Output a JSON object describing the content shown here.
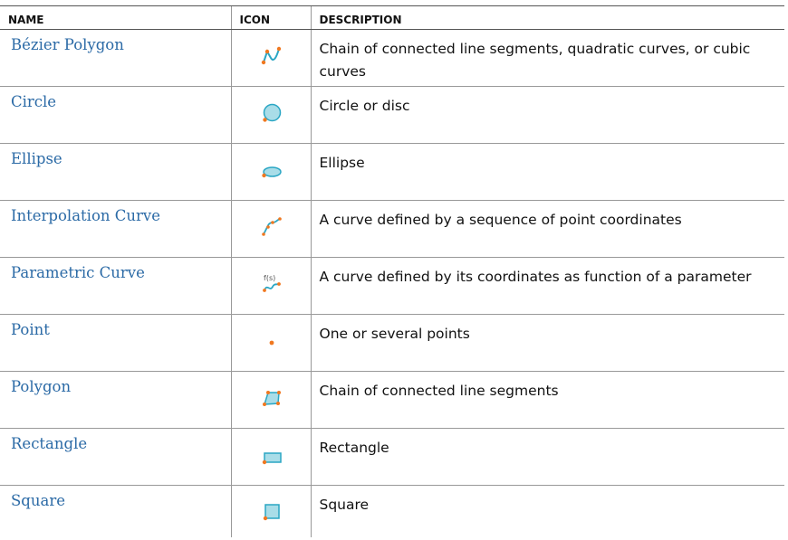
{
  "headers": {
    "name": "NAME",
    "icon": "ICON",
    "description": "DESCRIPTION"
  },
  "rows": [
    {
      "name": "Bézier Polygon",
      "icon": "bezier-polygon-icon",
      "description": "Chain of connected line segments, quadratic curves, or cubic curves"
    },
    {
      "name": "Circle",
      "icon": "circle-icon",
      "description": "Circle or disc"
    },
    {
      "name": "Ellipse",
      "icon": "ellipse-icon",
      "description": "Ellipse"
    },
    {
      "name": "Interpolation Curve",
      "icon": "interpolation-curve-icon",
      "description": "A curve defined by a sequence of point coordinates"
    },
    {
      "name": "Parametric Curve",
      "icon": "parametric-curve-icon",
      "icon_text": "f(s)",
      "description": "A curve defined by its coordinates as function of a parameter"
    },
    {
      "name": "Point",
      "icon": "point-icon",
      "description": "One or several points"
    },
    {
      "name": "Polygon",
      "icon": "polygon-icon",
      "description": "Chain of connected line segments"
    },
    {
      "name": "Rectangle",
      "icon": "rectangle-icon",
      "description": "Rectangle"
    },
    {
      "name": "Square",
      "icon": "square-icon",
      "description": "Square"
    }
  ],
  "colors": {
    "link": "#2b6aa6",
    "icon_fill": "#a9dde8",
    "icon_stroke": "#2aa6c4",
    "icon_point": "#f07820"
  }
}
